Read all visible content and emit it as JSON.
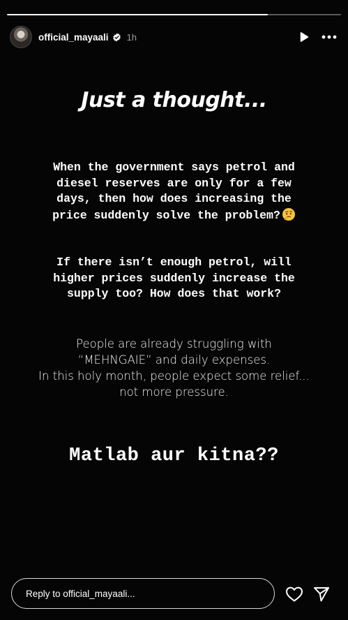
{
  "story": {
    "progress_fraction": 0.78,
    "user": {
      "username": "official_mayaali",
      "verified": true,
      "time_ago": "1h"
    },
    "icons": {
      "play": "play-icon",
      "more": "more-options-icon",
      "verified": "verified-badge-icon",
      "like": "heart-icon",
      "share": "send-icon",
      "emoji": "thinking-face-emoji"
    },
    "content": {
      "headline": "Just a thought...",
      "para1_lines": [
        "When the government says petrol and",
        "diesel reserves are only for a few",
        "days, then how does increasing the",
        "price suddenly solve the problem?"
      ],
      "para2_lines": [
        "If there isn’t enough petrol, will",
        "higher prices suddenly increase the",
        "supply too? How does that work?"
      ],
      "para3_lines": [
        "People are already struggling with",
        "“MEHNGAIE” and daily expenses.",
        "In this holy month, people expect some relief...",
        "not more pressure."
      ],
      "closing": "Matlab aur kitna??"
    },
    "reply": {
      "placeholder": "Reply to official_mayaali..."
    }
  }
}
